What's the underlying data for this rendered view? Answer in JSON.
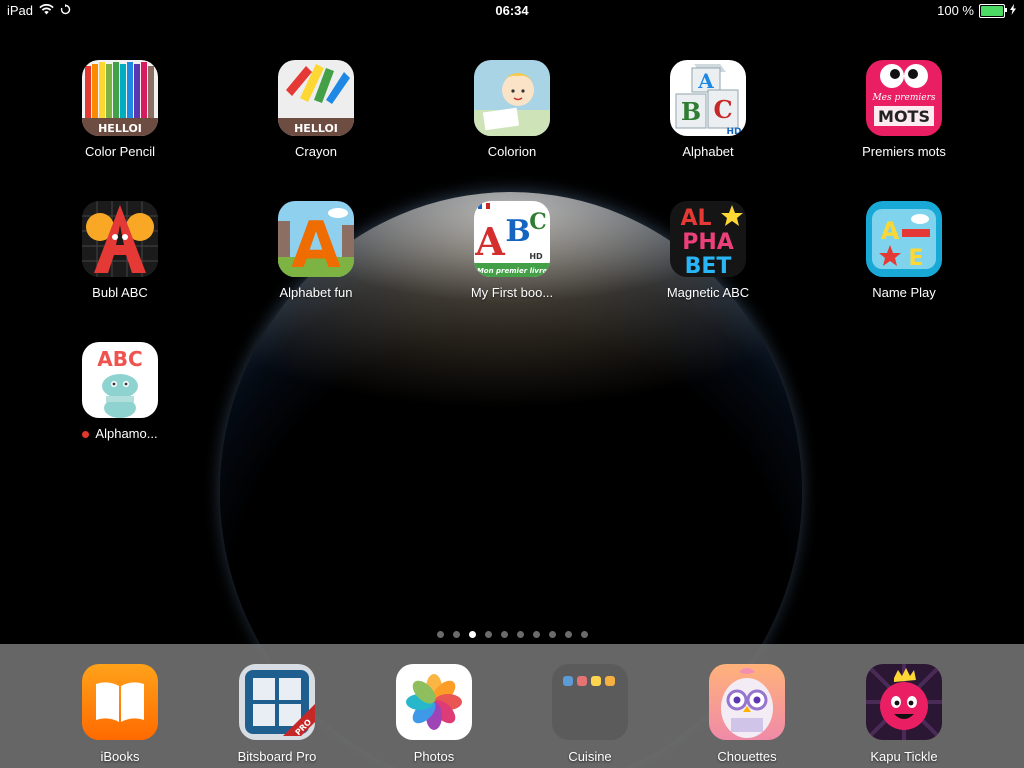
{
  "status_bar": {
    "device": "iPad",
    "time": "06:34",
    "battery": "100 %",
    "battery_level": 1.0
  },
  "apps": [
    {
      "label": "Color Pencil",
      "icon": "color-pencil-icon"
    },
    {
      "label": "Crayon",
      "icon": "crayon-icon"
    },
    {
      "label": "Colorion",
      "icon": "colorion-icon"
    },
    {
      "label": "Alphabet",
      "icon": "alphabet-blocks-icon"
    },
    {
      "label": "Premiers mots",
      "icon": "premiers-mots-icon"
    },
    {
      "label": "Bubl ABC",
      "icon": "bubl-abc-icon"
    },
    {
      "label": "Alphabet fun",
      "icon": "alphabet-fun-icon"
    },
    {
      "label": "My First boo...",
      "icon": "my-first-book-icon"
    },
    {
      "label": "Magnetic ABC",
      "icon": "magnetic-abc-icon"
    },
    {
      "label": "Name Play",
      "icon": "name-play-icon"
    },
    {
      "label": "Alphamo...",
      "icon": "alphamo-icon"
    }
  ],
  "icon_text": {
    "helloi": "HELLOI",
    "abc_block_a": "A",
    "abc_block_b": "B",
    "abc_block_c": "C",
    "hd": "HD",
    "mes_premiers": "Mes premiers",
    "mots": "MOTS",
    "big_a": "A",
    "mfb_a": "A",
    "mfb_b": "B",
    "mfb_c": "C",
    "mon_premier_livre": "Mon premier livre",
    "mag_l1": "AL",
    "mag_l2": "PHA",
    "mag_l3": "BET",
    "np_a": "A",
    "np_e": "E",
    "alphamo_abc": "ABC",
    "pro": "PRO"
  },
  "page_dots": {
    "count": 10,
    "active_index": 2
  },
  "dock": [
    {
      "label": "iBooks",
      "icon": "ibooks-icon"
    },
    {
      "label": "Bitsboard Pro",
      "icon": "bitsboard-pro-icon"
    },
    {
      "label": "Photos",
      "icon": "photos-icon"
    },
    {
      "label": "Cuisine",
      "icon": "folder-icon"
    },
    {
      "label": "Chouettes",
      "icon": "chouettes-icon"
    },
    {
      "label": "Kapu Tickle",
      "icon": "kapu-tickle-icon"
    }
  ],
  "colors": {
    "dock_bg": "#787878",
    "battery_green": "#4cd964",
    "badge_red": "#e2372c"
  }
}
